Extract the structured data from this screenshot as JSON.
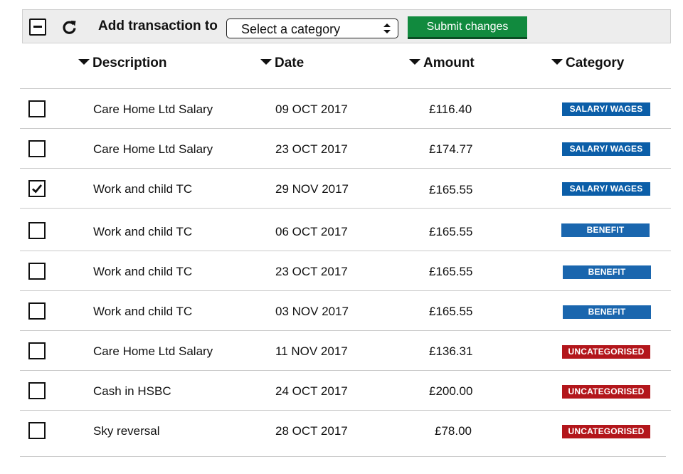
{
  "toolbar": {
    "label": "Add transaction to",
    "select_value": "Select a category",
    "submit_label": "Submit changes",
    "collapse_icon": "collapse-minus-icon",
    "refresh_icon": "refresh-icon"
  },
  "columns": {
    "description": "Description",
    "date": "Date",
    "amount": "Amount",
    "category": "Category"
  },
  "colors": {
    "salary": "#0b5ea8",
    "benefit": "#1a66ae",
    "uncategorised": "#b3161b",
    "submit": "#118a3e"
  },
  "rows": [
    {
      "checked": false,
      "description": "Care Home Ltd Salary",
      "date": "09 OCT 2017",
      "amount": "£116.40",
      "category": "SALARY/ WAGES",
      "category_type": "salary"
    },
    {
      "checked": false,
      "description": "Care Home Ltd Salary",
      "date": "23 OCT 2017",
      "amount": "£174.77",
      "category": "SALARY/ WAGES",
      "category_type": "salary"
    },
    {
      "checked": true,
      "description": "Work and child TC",
      "date": "29 NOV 2017",
      "amount": "£165.55",
      "category": "SALARY/ WAGES",
      "category_type": "salary"
    },
    {
      "checked": false,
      "description": "Work and child TC",
      "date": "06 OCT 2017",
      "amount": "£165.55",
      "category": "BENEFIT",
      "category_type": "benefit"
    },
    {
      "checked": false,
      "description": "Work and child TC",
      "date": "23 OCT 2017",
      "amount": "£165.55",
      "category": "BENEFIT",
      "category_type": "benefit"
    },
    {
      "checked": false,
      "description": "Work and child TC",
      "date": "03 NOV 2017",
      "amount": "£165.55",
      "category": "BENEFIT",
      "category_type": "benefit"
    },
    {
      "checked": false,
      "description": "Care Home Ltd Salary",
      "date": "11 NOV 2017",
      "amount": "£136.31",
      "category": "UNCATEGORISED",
      "category_type": "uncategorised"
    },
    {
      "checked": false,
      "description": "Cash in HSBC",
      "date": "24 OCT 2017",
      "amount": "£200.00",
      "category": "UNCATEGORISED",
      "category_type": "uncategorised"
    },
    {
      "checked": false,
      "description": "Sky reversal",
      "date": "28 OCT 2017",
      "amount": "£78.00",
      "category": "UNCATEGORISED",
      "category_type": "uncategorised"
    }
  ]
}
